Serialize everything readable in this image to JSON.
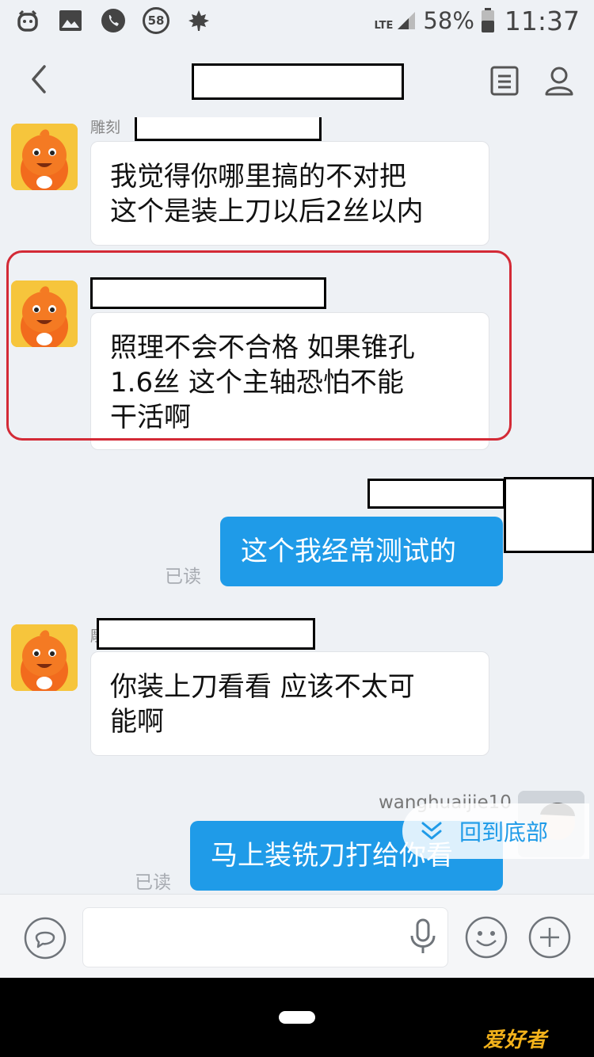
{
  "status_bar": {
    "network": "LTE",
    "battery_percent": "58%",
    "time": "11:37",
    "badge_58": "58"
  },
  "messages": {
    "m1": {
      "sender_partial": "雕刻",
      "text": "我觉得你哪里搞的不对把\n这个是装上刀以后2丝以内"
    },
    "m2": {
      "text": "照理不会不合格  如果锥孔\n1.6丝  这个主轴恐怕不能\n干活啊"
    },
    "m3": {
      "text": "这个我经常测试的",
      "read": "已读"
    },
    "m4": {
      "sender_partial": "雕",
      "text": "你装上刀看看 应该不太可\n能啊"
    },
    "m5": {
      "sender": "wanghuaijie10",
      "text": "马上装铣刀打给你看",
      "read": "已读"
    }
  },
  "scroll_to_bottom": {
    "label": "回到底部"
  },
  "watermark": "爱好者",
  "colors": {
    "accent": "#1f9be8",
    "highlight": "#d32a36",
    "background": "#eef1f5"
  }
}
